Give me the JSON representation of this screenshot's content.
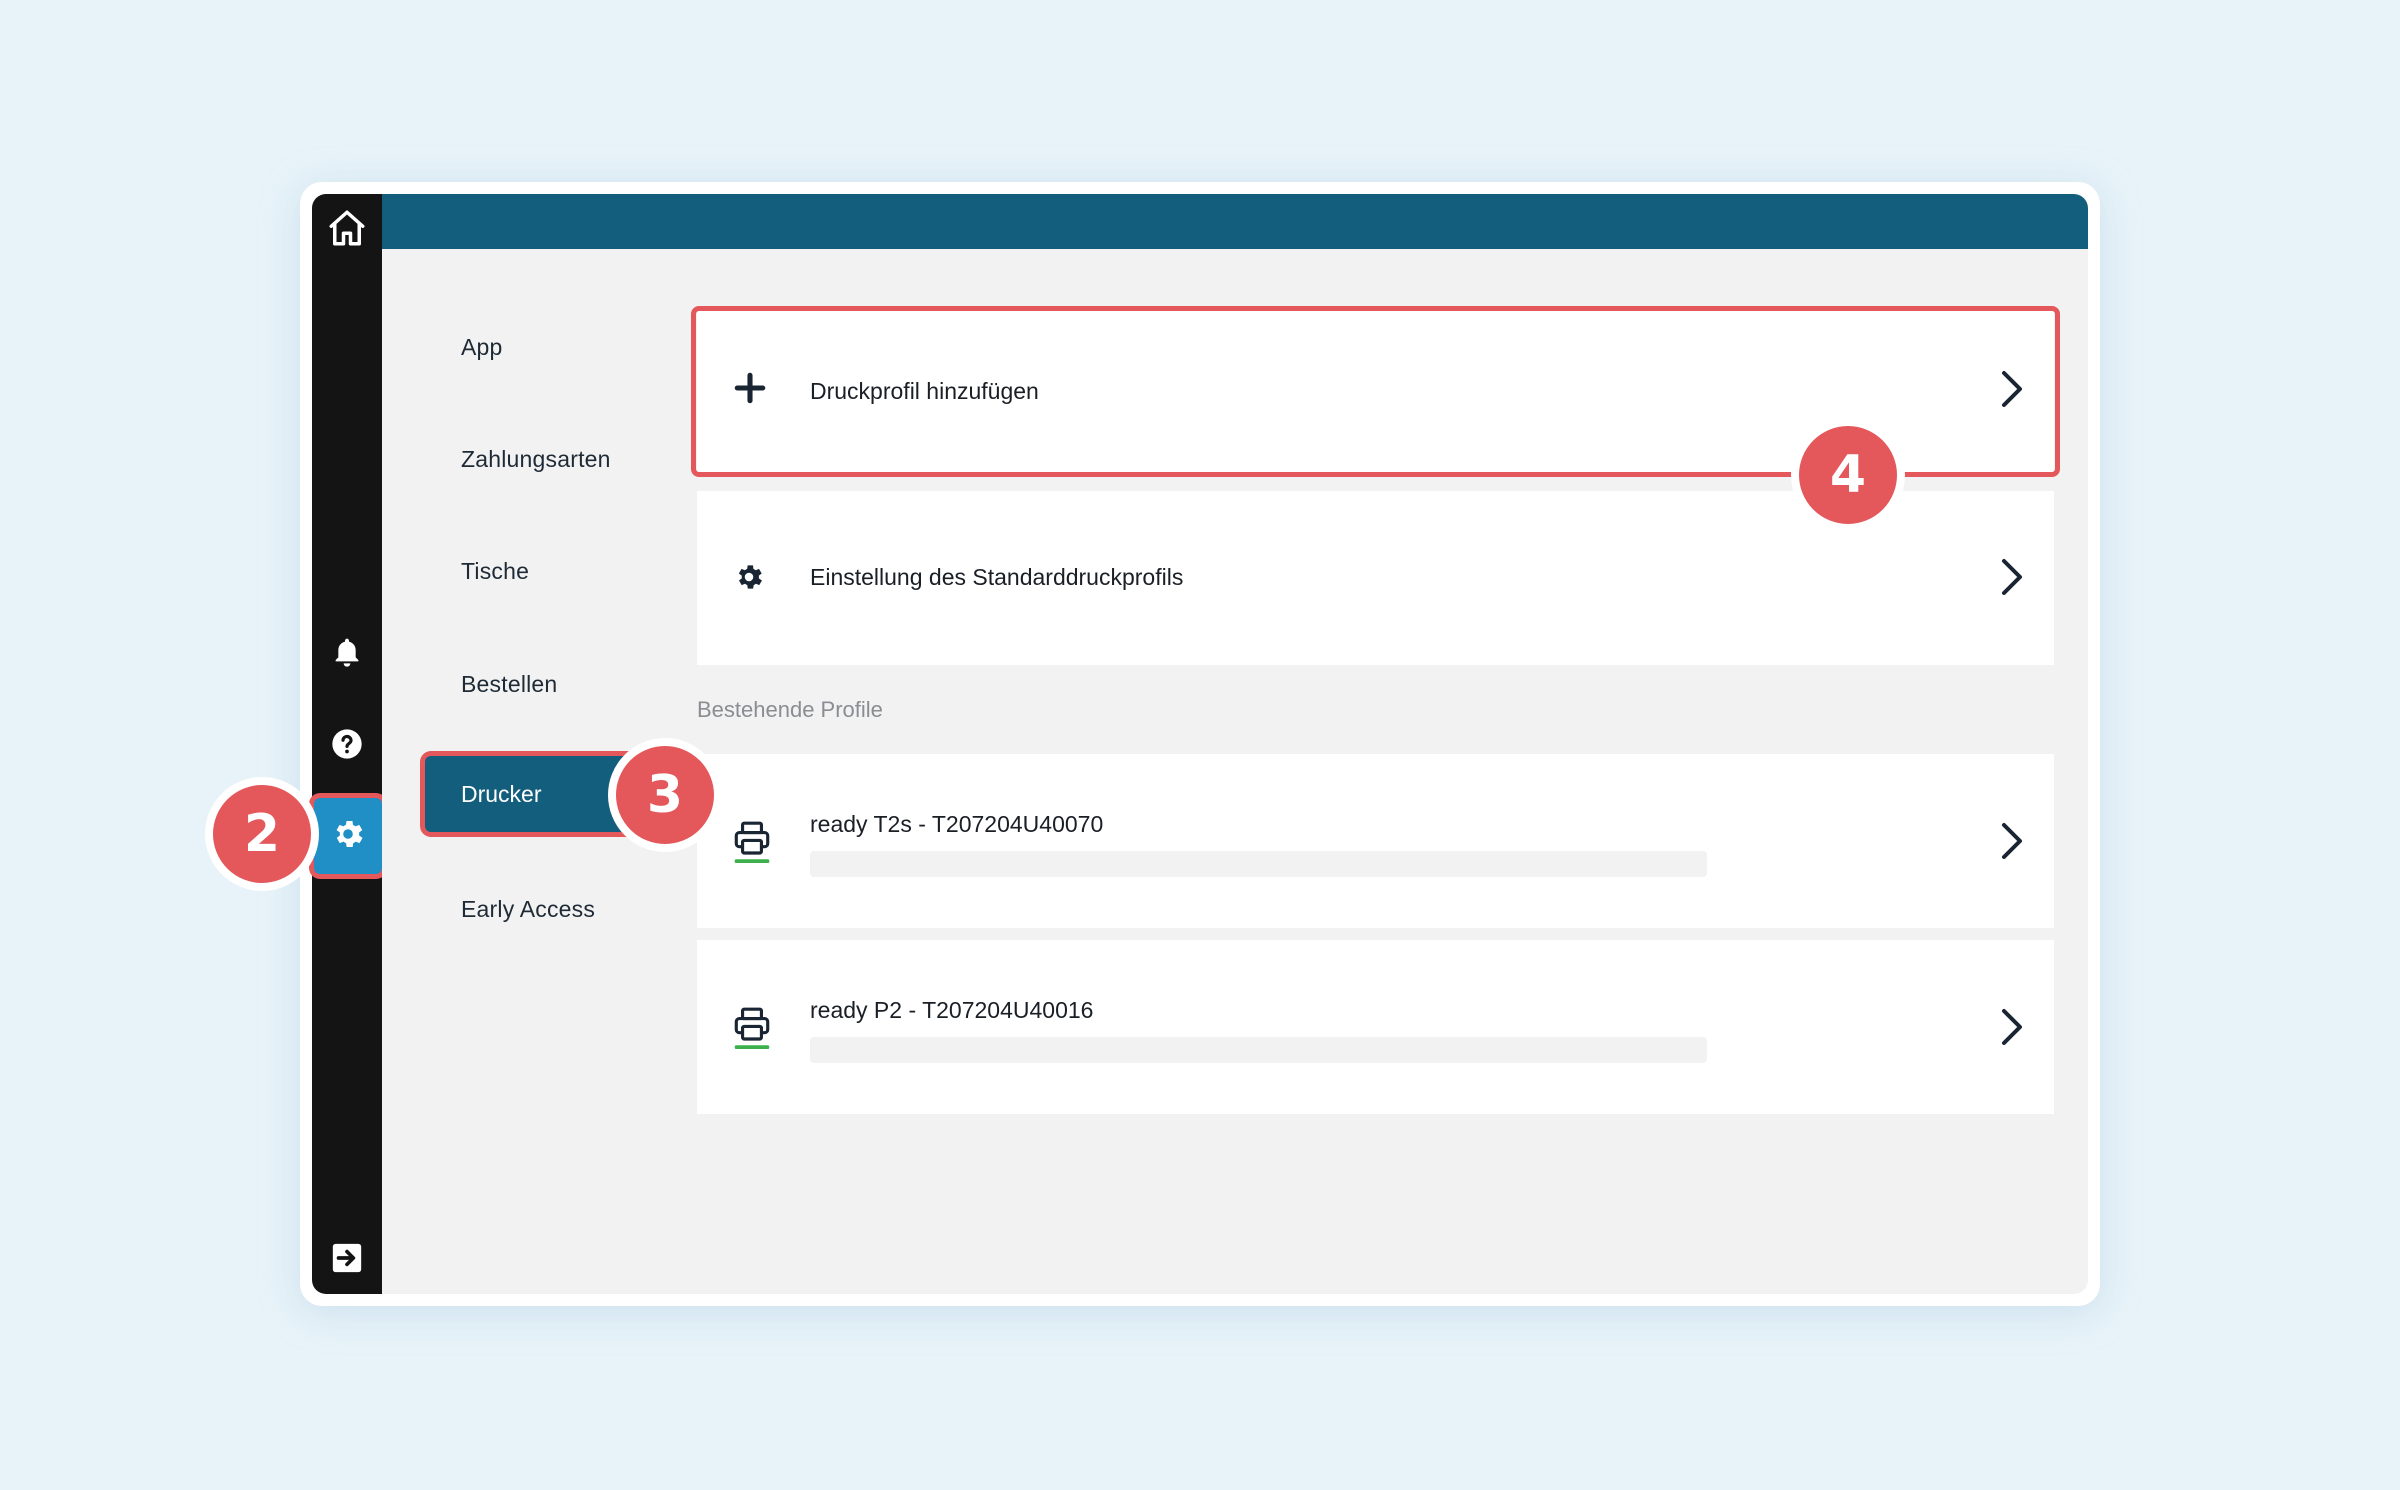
{
  "sidebar": {
    "icons": {
      "home": "home-icon",
      "bell": "bell-icon",
      "help": "help-icon",
      "settings": "gear-icon",
      "logout": "logout-icon"
    }
  },
  "nav": {
    "items": [
      {
        "label": "App"
      },
      {
        "label": "Zahlungsarten"
      },
      {
        "label": "Tische"
      },
      {
        "label": "Bestellen"
      },
      {
        "label": "Drucker"
      },
      {
        "label": "Early Access"
      }
    ],
    "active_index": 4
  },
  "actions": {
    "add_profile": "Druckprofil hinzufügen",
    "default_profile": "Einstellung des Standarddruckprofils"
  },
  "profiles": {
    "section_title": "Bestehende Profile",
    "items": [
      {
        "name": "ready T2s - T207204U40070"
      },
      {
        "name": "ready P2 - T207204U40016"
      }
    ]
  },
  "annotations": {
    "settings_step": "2",
    "drucker_step": "3",
    "add_step": "4"
  },
  "colors": {
    "accent": "#135e7c",
    "highlight": "#e4575a",
    "active_icon_bg": "#1f8fc6",
    "printer_status": "#3cb04a"
  }
}
